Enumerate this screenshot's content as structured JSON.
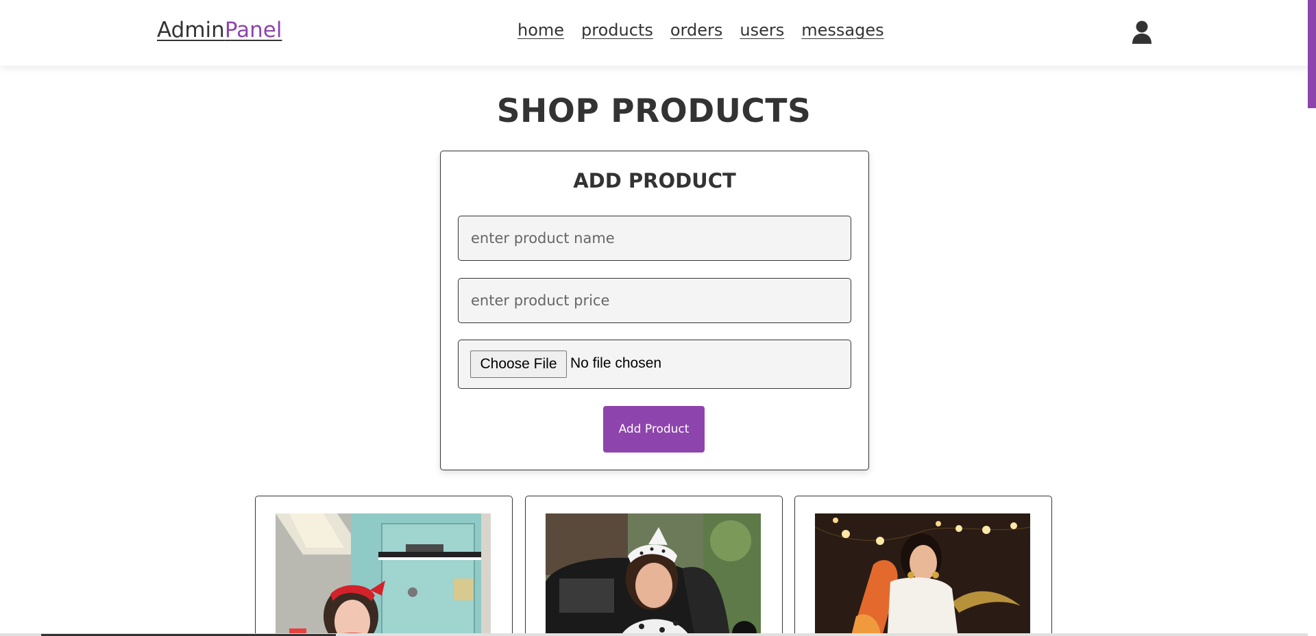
{
  "header": {
    "logo_main": "Admin",
    "logo_accent": "Panel",
    "nav": [
      "home",
      "products",
      "orders",
      "users",
      "messages"
    ],
    "user_icon": "user-icon"
  },
  "page": {
    "title": "SHOP PRODUCTS"
  },
  "form": {
    "title": "ADD PRODUCT",
    "name_placeholder": "enter product name",
    "price_placeholder": "enter product price",
    "file_button_label": "Choose File",
    "file_status": "No file chosen",
    "submit_label": "Add Product"
  },
  "colors": {
    "accent": "#8e44ad",
    "text": "#333333",
    "field_bg": "#f4f4f4"
  }
}
